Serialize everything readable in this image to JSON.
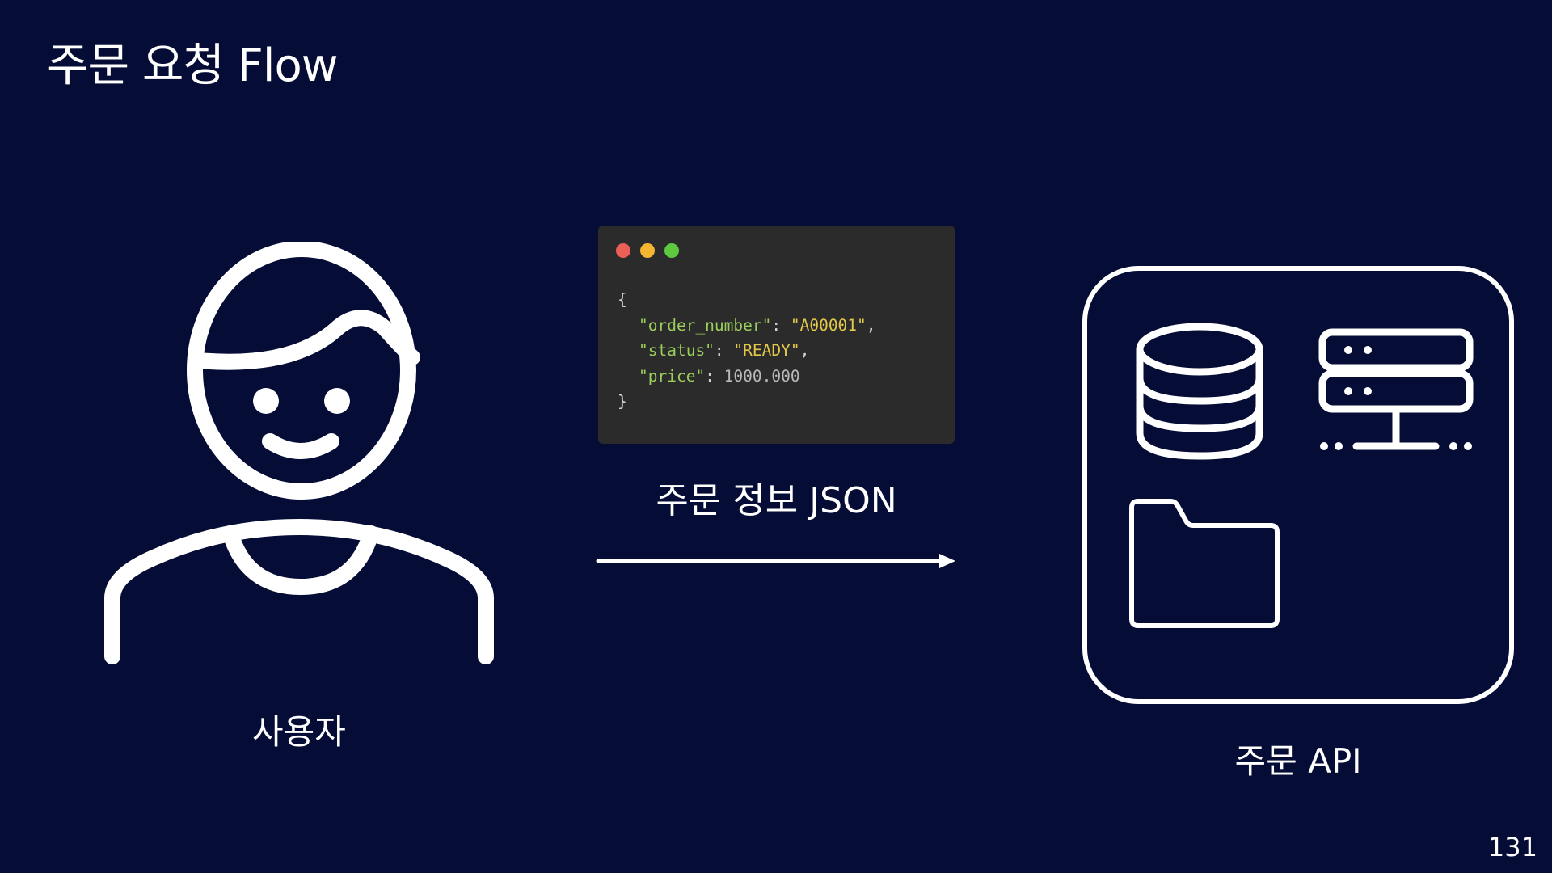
{
  "slide": {
    "title": "주문 요청 Flow",
    "page_number": "131"
  },
  "user": {
    "icon": "user-icon",
    "label": "사용자"
  },
  "request": {
    "window_dots": [
      {
        "name": "close-dot",
        "color": "#ec5f55"
      },
      {
        "name": "minimize-dot",
        "color": "#f5b731"
      },
      {
        "name": "maximize-dot",
        "color": "#5cc940"
      }
    ],
    "code": {
      "open_brace": "{",
      "close_brace": "}",
      "fields": [
        {
          "key": "\"order_number\"",
          "value": "\"A00001\"",
          "value_type": "string",
          "trailing_comma": true
        },
        {
          "key": "\"status\"",
          "value": "\"READY\"",
          "value_type": "string",
          "trailing_comma": true
        },
        {
          "key": "\"price\"",
          "value": "1000.000",
          "value_type": "number",
          "trailing_comma": false
        }
      ]
    },
    "label": "주문 정보 JSON",
    "arrow_icon": "arrow-right-icon"
  },
  "api": {
    "icons": [
      "database-icon",
      "server-icon",
      "folder-icon"
    ],
    "label": "주문 API"
  },
  "colors": {
    "background": "#050c35",
    "foreground": "#ffffff",
    "code_background": "#2b2b2b",
    "json_key": "#9acd5c",
    "json_string": "#e3c84a",
    "json_number": "#b9b9b9"
  }
}
